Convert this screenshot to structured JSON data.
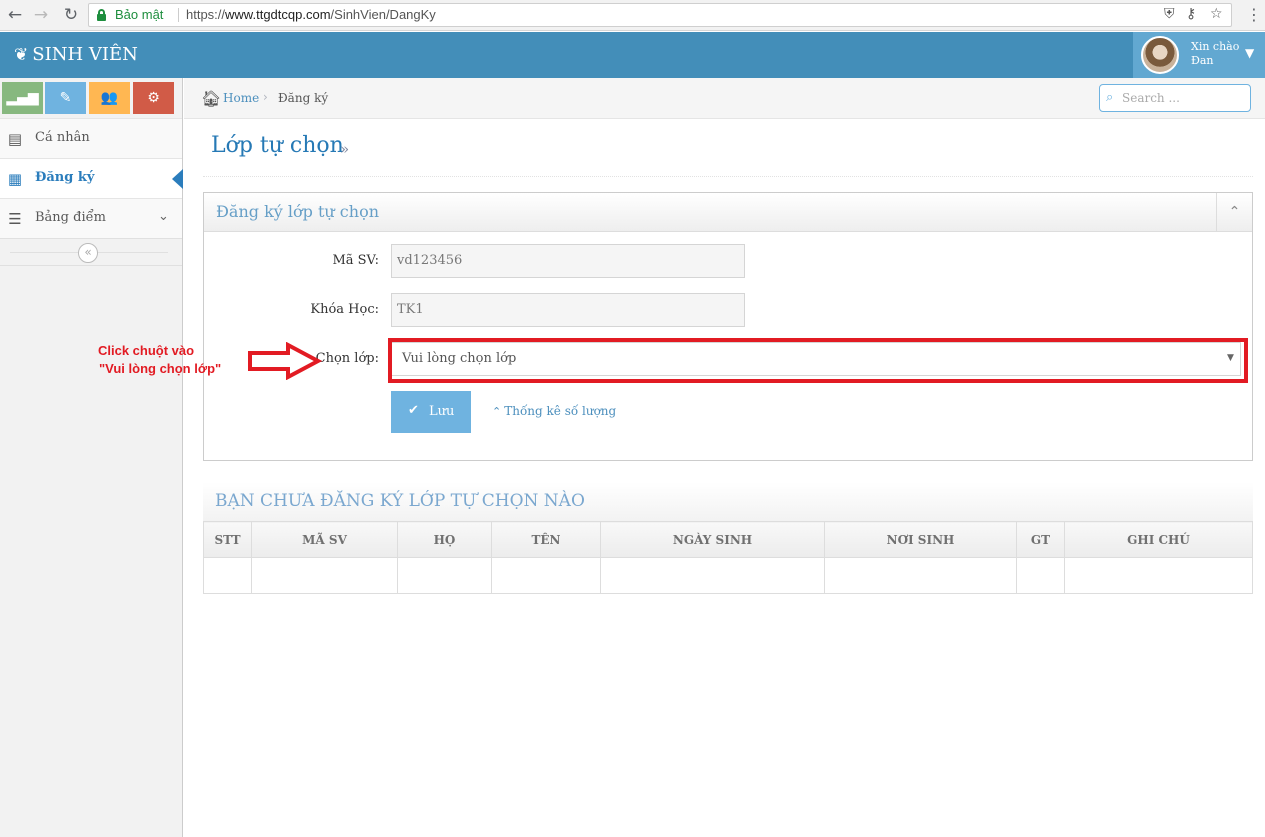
{
  "browser": {
    "secure_label": "Bảo mật",
    "url_prefix": "https://",
    "url_host": "www.ttgdtcqp.com",
    "url_path": "/SinhVien/DangKy"
  },
  "header": {
    "brand": "SINH VIÊN",
    "greeting": "Xin chào",
    "user_name": "Đan",
    "color": "#438eb9"
  },
  "sidebar": {
    "shortcuts": [
      "signal-icon",
      "pencil-icon",
      "users-icon",
      "cogs-icon"
    ],
    "items": [
      {
        "label": "Cá nhân",
        "icon": "list-alt-icon"
      },
      {
        "label": "Đăng ký",
        "icon": "calendar-icon",
        "active": true
      },
      {
        "label": "Bảng điểm",
        "icon": "list-icon",
        "has_submenu": true
      }
    ]
  },
  "breadcrumbs": {
    "home": "Home",
    "current": "Đăng ký",
    "search_placeholder": "Search ..."
  },
  "page": {
    "title": "Lớp tự chọn",
    "title_suffix": "»"
  },
  "form": {
    "box_title": "Đăng ký lớp tự chọn",
    "student_id_label": "Mã SV:",
    "student_id_value": "vd123456",
    "course_label": "Khóa Học:",
    "course_value": "TK1",
    "class_label": "Chọn lớp:",
    "class_selected": "Vui lòng chọn lớp",
    "save_label": "Lưu",
    "stats_link": "Thống kê số lượng"
  },
  "annotation": {
    "line1": "Click chuột vào",
    "line2": "\"Vui lòng chọn lớp\"",
    "color": "#e21b23"
  },
  "table": {
    "title": "BẠN CHƯA ĐĂNG KÝ LỚP TỰ CHỌN NÀO",
    "columns": [
      "STT",
      "MÃ SV",
      "HỌ",
      "TÊN",
      "NGÀY SINH",
      "NƠI SINH",
      "GT",
      "GHI CHÚ"
    ],
    "rows": []
  }
}
